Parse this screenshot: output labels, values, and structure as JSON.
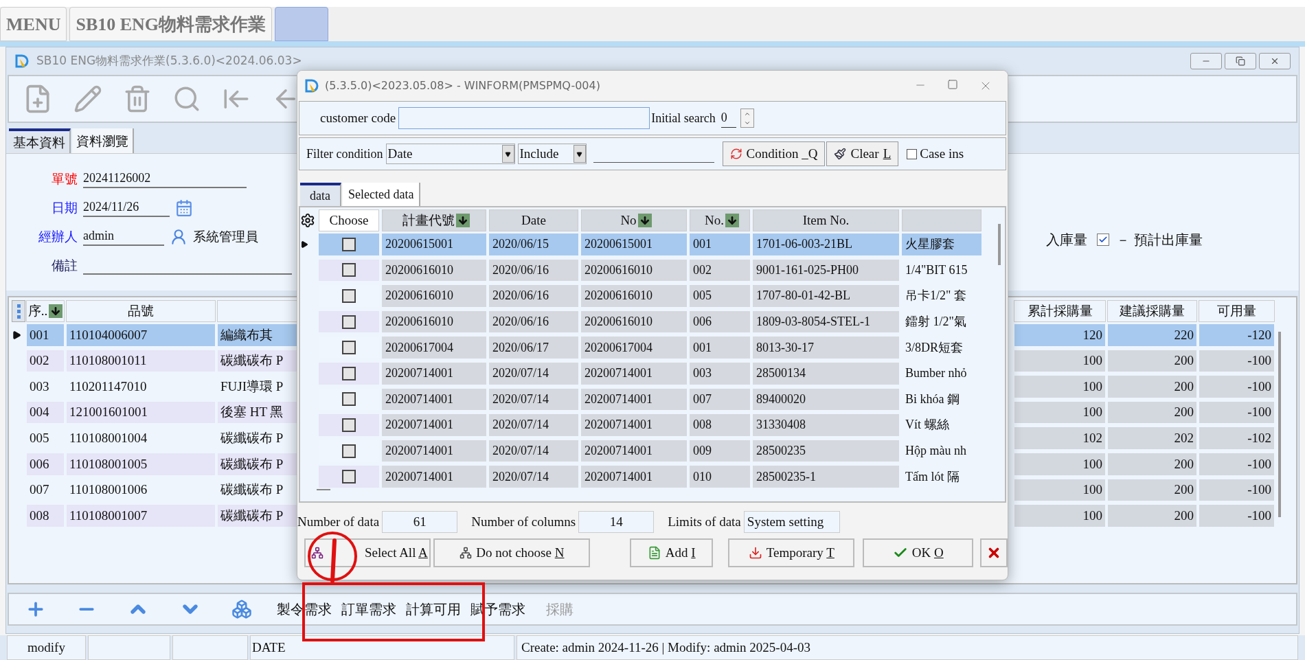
{
  "menu_tabs": [
    {
      "label": "MENU",
      "selected": false
    },
    {
      "label": "SB10 ENG物料需求作業",
      "selected": false
    },
    {
      "selected": true
    }
  ],
  "main_window": {
    "title": "SB10 ENG物料需求作業(5.3.6.0)<2024.06.03>",
    "tabs": [
      {
        "label": "基本資料",
        "selected": true
      },
      {
        "label": "資料瀏覽",
        "selected": false
      }
    ],
    "fields": [
      {
        "label": "單號",
        "color": "#ff0000",
        "kind": "text",
        "value": "20241126002"
      },
      {
        "label": "日期",
        "color": "#1a1aff",
        "kind": "date",
        "value": "2024/11/26"
      },
      {
        "label": "經辦人",
        "color": "#1a1aff",
        "kind": "user",
        "value": "admin",
        "note": "系統管理員"
      },
      {
        "label": "備註",
        "color": "#1c1c5c",
        "kind": "text"
      }
    ],
    "options": [
      {
        "kind": "text",
        "label": "入庫量"
      },
      {
        "kind": "checkbox",
        "label": "－ 預計出庫量",
        "checked": true
      }
    ],
    "grid": {
      "columns": [
        {
          "label": "序..",
          "sortable": true
        },
        {
          "label": "品號",
          "sortable": false
        },
        {
          "sortable": false
        },
        {
          "label": "累計採購量",
          "sortable": false
        },
        {
          "label": "建議採購量",
          "sortable": false
        },
        {
          "label": "可用量",
          "sortable": false
        }
      ],
      "rows": [
        {
          "selected": true,
          "cells": [
            "001",
            "110104006007",
            "編織布其",
            "120",
            "220",
            "-120"
          ]
        },
        {
          "selected": false,
          "cells": [
            "002",
            "110108001011",
            "碳纖碳布 P",
            "100",
            "200",
            "-100"
          ]
        },
        {
          "selected": false,
          "cells": [
            "003",
            "110201147010",
            "FUJI導環 P",
            "100",
            "200",
            "-100"
          ]
        },
        {
          "selected": false,
          "cells": [
            "004",
            "121001601001",
            "後塞 HT 黑",
            "100",
            "200",
            "-100"
          ]
        },
        {
          "selected": false,
          "cells": [
            "005",
            "110108001004",
            "碳纖碳布 P",
            "102",
            "202",
            "-102"
          ]
        },
        {
          "selected": false,
          "cells": [
            "006",
            "110108001005",
            "碳纖碳布 P",
            "100",
            "200",
            "-100"
          ]
        },
        {
          "selected": false,
          "cells": [
            "007",
            "110108001006",
            "碳纖碳布 P",
            "100",
            "200",
            "-100"
          ]
        },
        {
          "selected": false,
          "cells": [
            "008",
            "110108001007",
            "碳纖碳布 P",
            "100",
            "200",
            "-100"
          ]
        }
      ]
    },
    "actions": [
      {
        "label": "製令需求",
        "disabled": false
      },
      {
        "label": "訂單需求",
        "disabled": false
      },
      {
        "label": "計算可用",
        "disabled": false
      },
      {
        "label": "賦予需求",
        "disabled": false
      },
      {
        "label": "採購",
        "disabled": true
      }
    ],
    "status_bar": {
      "mode": "modify",
      "field": "DATE",
      "audit": "Create: admin 2024-11-26 | Modify: admin 2025-04-03"
    }
  },
  "dialog": {
    "title": "(5.3.5.0)<2023.05.08> - WINFORM(PMSPMQ-004)",
    "search": {
      "label": "customer code",
      "initial_label": "Initial search",
      "initial_value": "0"
    },
    "filter": {
      "label": "Filter condition",
      "field": "Date",
      "operator": "Include",
      "buttons": [
        {
          "kind": "condition",
          "label": "Condition _Q"
        },
        {
          "kind": "clear",
          "label": "Clear",
          "key": "L"
        }
      ],
      "case": {
        "label": "Case ins",
        "checked": false
      }
    },
    "tabs": [
      {
        "label": "data",
        "selected": true
      },
      {
        "label": "Selected data",
        "selected": false
      }
    ],
    "grid": {
      "choose_label": "Choose",
      "columns": [
        {
          "label": "計畫代號",
          "sortable": true
        },
        {
          "label": "Date",
          "sortable": false
        },
        {
          "label": "No",
          "sortable": true
        },
        {
          "label": "No.",
          "sortable": true
        },
        {
          "label": "Item No.",
          "sortable": false
        },
        {
          "sortable": false
        }
      ],
      "rows": [
        {
          "selected": true,
          "checked": false,
          "cells": [
            "20200615001",
            "2020/06/15",
            "20200615001",
            "001",
            "1701-06-003-21BL",
            "火星膠套"
          ]
        },
        {
          "selected": false,
          "checked": false,
          "cells": [
            "20200616010",
            "2020/06/16",
            "20200616010",
            "002",
            "9001-161-025-PH00",
            "1/4\"BIT 615"
          ]
        },
        {
          "selected": false,
          "checked": false,
          "cells": [
            "20200616010",
            "2020/06/16",
            "20200616010",
            "005",
            "1707-80-01-42-BL",
            "吊卡1/2\" 套"
          ]
        },
        {
          "selected": false,
          "checked": false,
          "cells": [
            "20200616010",
            "2020/06/16",
            "20200616010",
            "006",
            "1809-03-8054-STEL-1",
            "鐳射 1/2\"氣"
          ]
        },
        {
          "selected": false,
          "checked": false,
          "cells": [
            "20200617004",
            "2020/06/17",
            "20200617004",
            "001",
            "8013-30-17",
            "3/8DR短套"
          ]
        },
        {
          "selected": false,
          "checked": false,
          "cells": [
            "20200714001",
            "2020/07/14",
            "20200714001",
            "003",
            "28500134",
            "Bumber nhỏ"
          ]
        },
        {
          "selected": false,
          "checked": false,
          "cells": [
            "20200714001",
            "2020/07/14",
            "20200714001",
            "007",
            "89400020",
            "Bi khóa 鋼"
          ]
        },
        {
          "selected": false,
          "checked": false,
          "cells": [
            "20200714001",
            "2020/07/14",
            "20200714001",
            "008",
            "31330408",
            "Vít 螺絲"
          ]
        },
        {
          "selected": false,
          "checked": false,
          "cells": [
            "20200714001",
            "2020/07/14",
            "20200714001",
            "009",
            "28500235",
            "Hộp màu nh"
          ]
        },
        {
          "selected": false,
          "checked": false,
          "cells": [
            "20200714001",
            "2020/07/14",
            "20200714001",
            "010",
            "28500235-1",
            "Tấm lót 隔"
          ]
        }
      ]
    },
    "stats": [
      {
        "label": "Number of data",
        "value": "61"
      },
      {
        "label": "Number of columns",
        "value": "14"
      },
      {
        "label": "Limits of data",
        "value": "System setting"
      }
    ],
    "buttons": [
      {
        "kind": "select_all",
        "label": "Select All",
        "key": "A"
      },
      {
        "kind": "deselect",
        "label": "Do not choose",
        "key": "N"
      },
      {
        "kind": "add",
        "label": "Add",
        "key": "I"
      },
      {
        "kind": "temporary",
        "label": "Temporary",
        "key": "T"
      },
      {
        "kind": "ok",
        "label": "OK",
        "key": "O"
      },
      {
        "kind": "cancel"
      }
    ]
  }
}
